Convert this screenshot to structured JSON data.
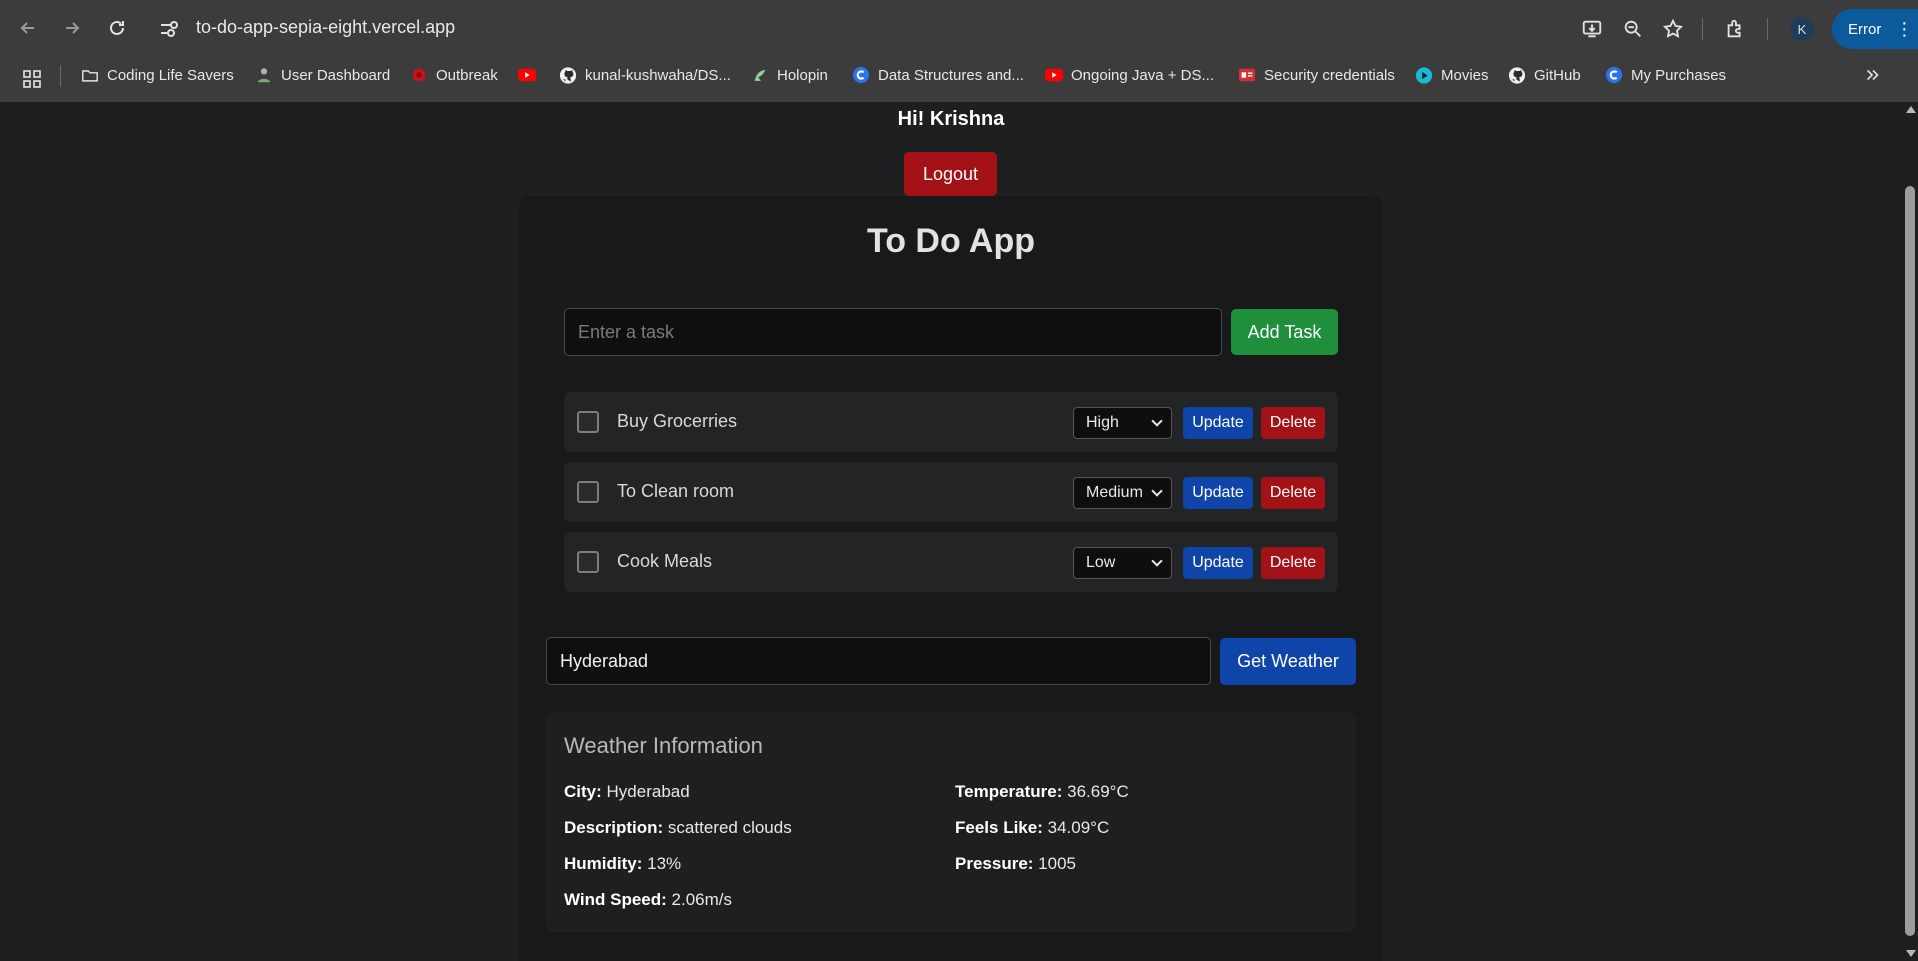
{
  "browser": {
    "url": "to-do-app-sepia-eight.vercel.app",
    "avatar_letter": "K",
    "error_label": "Error",
    "bookmarks": [
      {
        "label": "Coding Life Savers",
        "icon": "folder-icon"
      },
      {
        "label": "User Dashboard",
        "icon": "user-dashboard-icon"
      },
      {
        "label": "Outbreak",
        "icon": "outbreak-icon"
      },
      {
        "label": "",
        "icon": "youtube-icon"
      },
      {
        "label": "kunal-kushwaha/DS...",
        "icon": "github-icon"
      },
      {
        "label": "Holopin",
        "icon": "holopin-icon"
      },
      {
        "label": "Data Structures and...",
        "icon": "coursera-icon"
      },
      {
        "label": "Ongoing Java + DS...",
        "icon": "youtube-icon"
      },
      {
        "label": "Security credentials",
        "icon": "credentials-icon"
      },
      {
        "label": "Movies",
        "icon": "movies-icon"
      },
      {
        "label": "GitHub",
        "icon": "github-icon"
      },
      {
        "label": "My Purchases",
        "icon": "coursera-icon"
      }
    ]
  },
  "header": {
    "greeting": "Hi! Krishna",
    "logout_label": "Logout"
  },
  "app": {
    "title": "To Do App",
    "task_placeholder": "Enter a task",
    "add_task_label": "Add Task",
    "tasks": [
      {
        "name": "Buy Grocerries",
        "priority": "High",
        "update_label": "Update",
        "delete_label": "Delete"
      },
      {
        "name": "To Clean room",
        "priority": "Medium",
        "update_label": "Update",
        "delete_label": "Delete"
      },
      {
        "name": "Cook Meals",
        "priority": "Low",
        "update_label": "Update",
        "delete_label": "Delete"
      }
    ]
  },
  "weather": {
    "city_value": "Hyderabad",
    "get_weather_label": "Get Weather",
    "heading": "Weather Information",
    "city_label": "City:",
    "city": "Hyderabad",
    "description_label": "Description:",
    "description": "scattered clouds",
    "humidity_label": "Humidity:",
    "humidity": "13%",
    "wind_label": "Wind Speed:",
    "wind": "2.06m/s",
    "temperature_label": "Temperature:",
    "temperature": "36.69°C",
    "feels_label": "Feels Like:",
    "feels": "34.09°C",
    "pressure_label": "Pressure:",
    "pressure": "1005"
  },
  "colors": {
    "logout_red": "#a31217",
    "add_green": "#1f8f3c",
    "update_blue": "#0f45a8"
  }
}
